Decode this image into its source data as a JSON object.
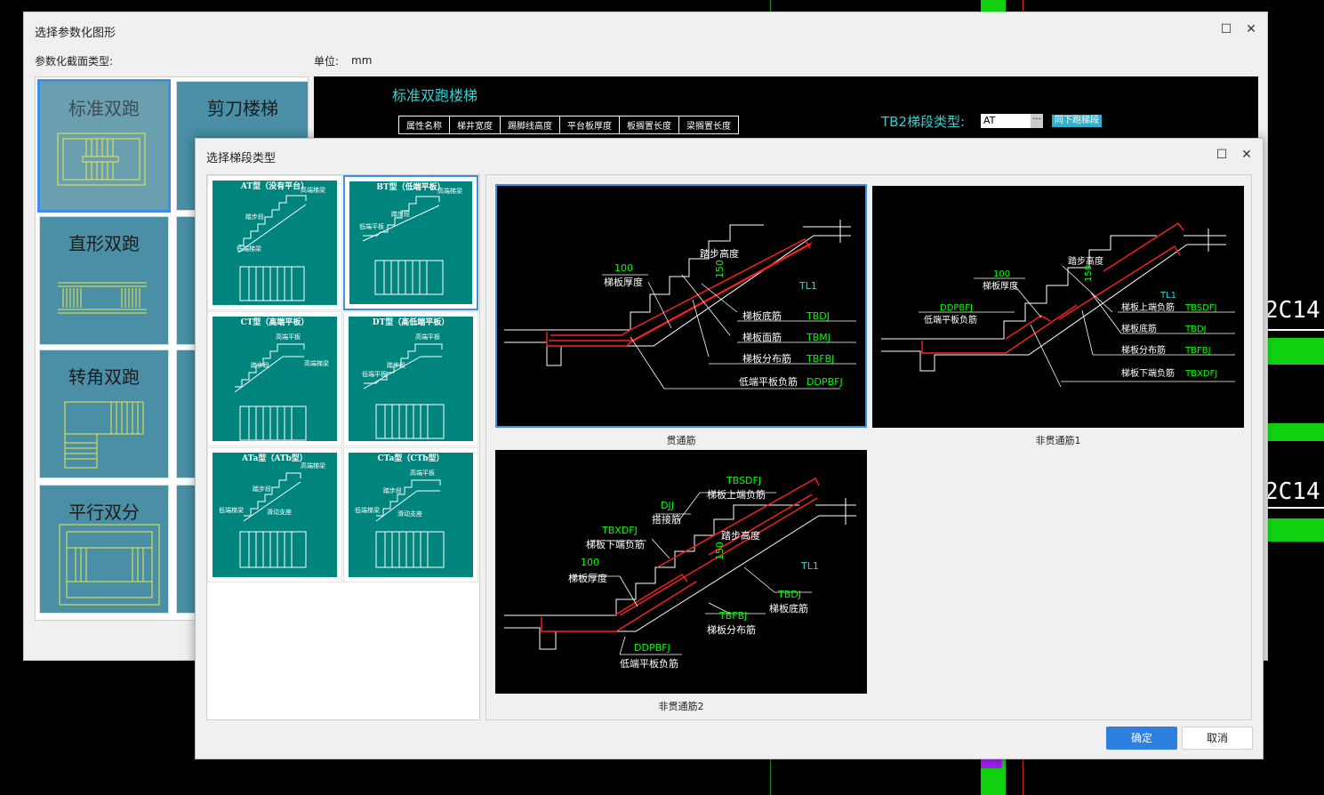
{
  "outer_dialog": {
    "title": "选择参数化图形",
    "section_label": "参数化截面类型:",
    "unit_label": "单位:",
    "unit_value": "mm",
    "shapes": [
      {
        "name": "标准双跑"
      },
      {
        "name": "剪刀楼梯"
      },
      {
        "name": "直形双跑"
      },
      {
        "name": "转角双跑"
      },
      {
        "name": "平行双分"
      }
    ],
    "preview": {
      "title": "标准双跑楼梯",
      "table_headers": [
        "属性名称",
        "梯井宽度",
        "踢脚线高度",
        "平台板厚度",
        "板搁置长度",
        "梁搁置长度"
      ],
      "tb2_label": "TB2梯段类型:",
      "tb2_value": "AT",
      "tb2_button": "同下跑梯段"
    }
  },
  "inner_dialog": {
    "title": "选择梯段类型",
    "types": [
      {
        "caption": "AT型（没有平台）"
      },
      {
        "caption": "BT型（低端平板）"
      },
      {
        "caption": "CT型（高端平板）"
      },
      {
        "caption": "DT型（高低端平板）"
      },
      {
        "caption": "ATa型（ATb型）"
      },
      {
        "caption": "CTa型（CTb型）"
      }
    ],
    "type_labels": {
      "step": "踏步段",
      "high_beam": "高端梯梁",
      "low_beam": "低端梯梁",
      "high_plate": "高端平板",
      "low_plate": "低端平板",
      "slide": "滑动支座"
    },
    "images": [
      {
        "caption": "贯通筋",
        "labels": {
          "h100": "100",
          "thick": "梯板厚度",
          "step_h": "踏步高度",
          "h150": "150",
          "tl1": "TL1",
          "bottom": "梯板底筋",
          "bottom_code": "TBDJ",
          "top": "梯板面筋",
          "top_code": "TBMJ",
          "dist": "梯板分布筋",
          "dist_code": "TBFBJ",
          "low": "低端平板负筋",
          "low_code": "DDPBFJ"
        }
      },
      {
        "caption": "非贯通筋1",
        "labels": {
          "h100": "100",
          "thick": "梯板厚度",
          "step_h": "踏步高度",
          "h150": "150",
          "tl1": "TL1",
          "ddpbfj": "DDPBFJ",
          "low": "低端平板负筋",
          "upper": "梯板上端负筋",
          "upper_code": "TBSDFJ",
          "bottom": "梯板底筋",
          "bottom_code": "TBDJ",
          "dist": "梯板分布筋",
          "dist_code": "TBFBJ",
          "lower": "梯板下端负筋",
          "lower_code": "TBXDFJ"
        }
      },
      {
        "caption": "非贯通筋2",
        "labels": {
          "tbsdfj": "TBSDFJ",
          "upper": "梯板上端负筋",
          "djj": "DJJ",
          "lap": "搭接筋",
          "tbxdfj": "TBXDFJ",
          "lower": "梯板下端负筋",
          "step_h": "踏步高度",
          "h150": "150",
          "tl1": "TL1",
          "h100": "100",
          "thick": "梯板厚度",
          "tbdj": "TBDJ",
          "bottom": "梯板底筋",
          "tbfbj": "TBFBJ",
          "dist": "梯板分布筋",
          "ddpbfj": "DDPBFJ",
          "low": "低端平板负筋"
        }
      }
    ],
    "ok_label": "确定",
    "cancel_label": "取消"
  },
  "background": {
    "cad_text_1": "2C14;",
    "cad_text_2": "2C14;"
  },
  "colors": {
    "accent": "#2d7fe0",
    "teal": "#00847e",
    "cyan": "#32d2d2",
    "cad_green": "#00ff00",
    "rebar_red": "#ff2020"
  }
}
